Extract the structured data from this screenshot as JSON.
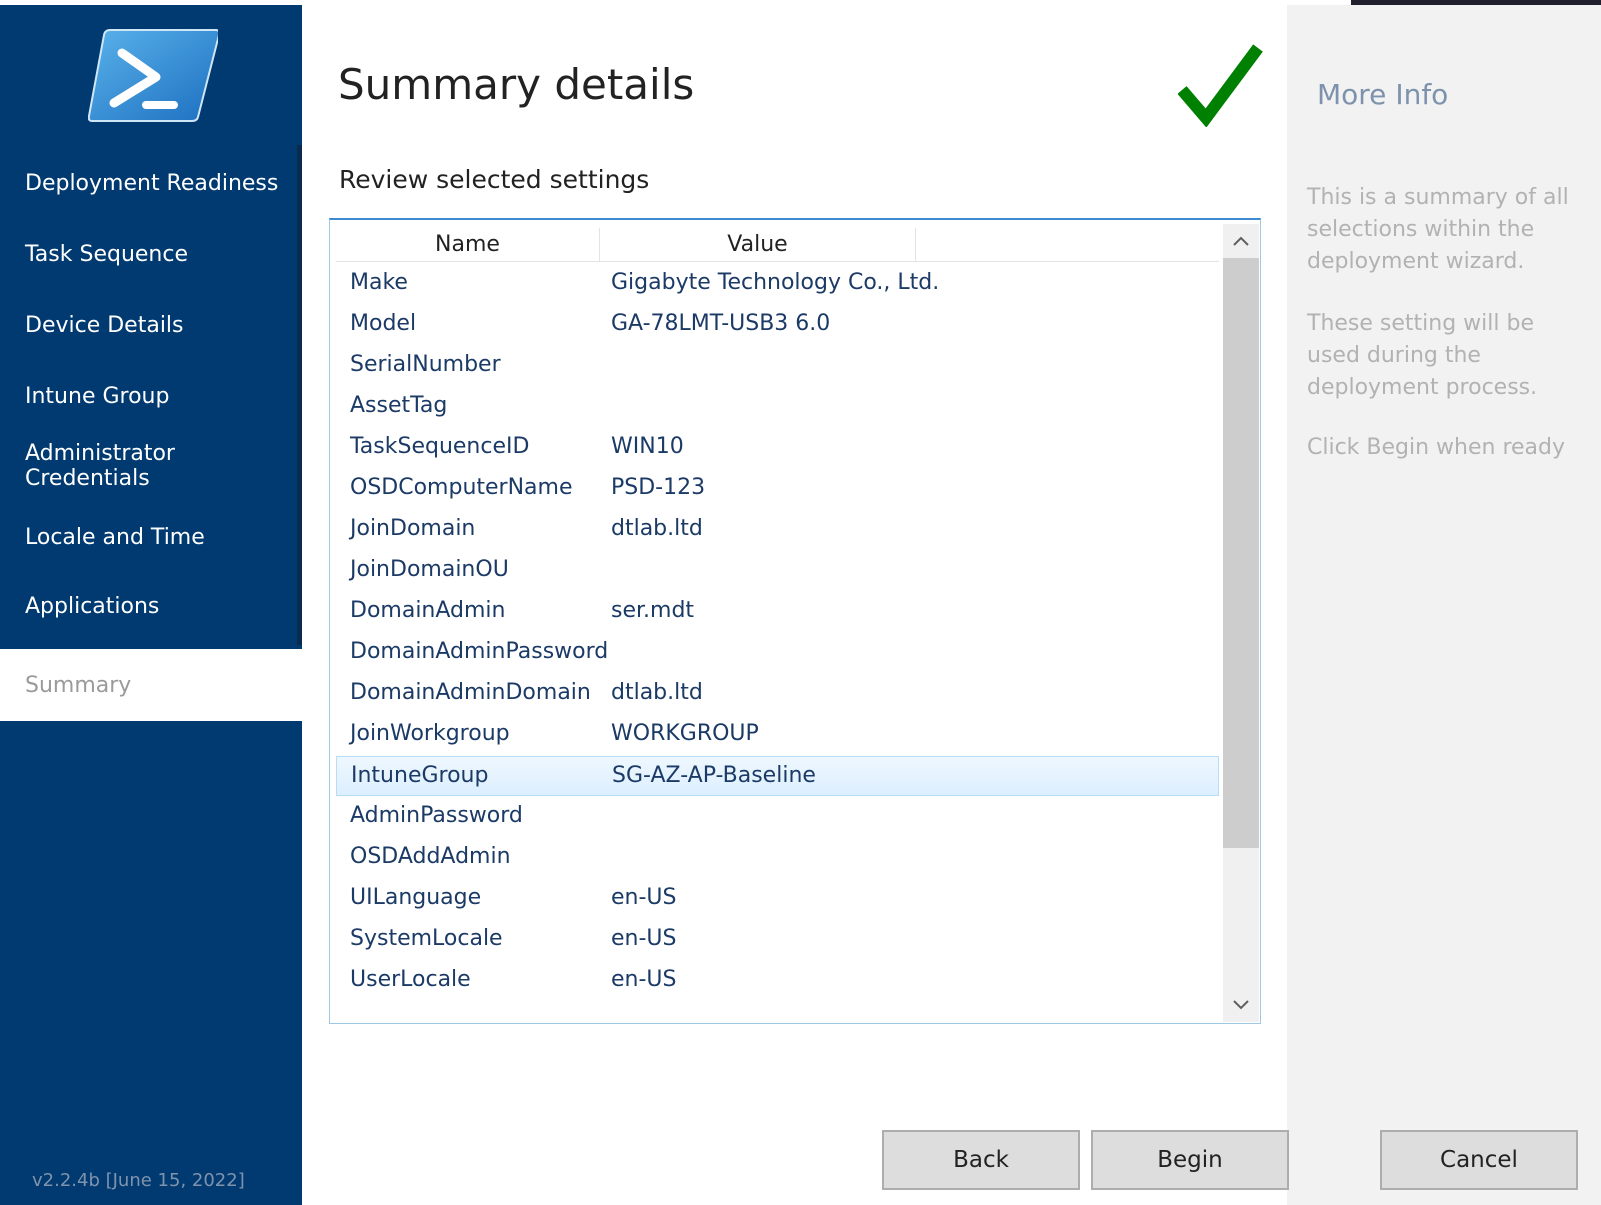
{
  "sidebar": {
    "logo_icon": "powershell-logo-icon",
    "items": [
      {
        "label": "Deployment Readiness"
      },
      {
        "label": "Task Sequence"
      },
      {
        "label": "Device Details"
      },
      {
        "label": "Intune Group"
      },
      {
        "label": "Administrator Credentials"
      },
      {
        "label": "Locale and Time"
      },
      {
        "label": "Applications"
      },
      {
        "label": "Summary",
        "active": true
      }
    ],
    "version": "v2.2.4b [June 15, 2022]",
    "colors": {
      "background": "#003a70",
      "active_background": "#ffffff",
      "active_text": "#9a9a9a"
    }
  },
  "main": {
    "title": "Summary details",
    "status_icon": "checkmark-icon",
    "status_color": "#008000",
    "subtitle": "Review selected settings",
    "grid": {
      "columns": [
        "Name",
        "Value"
      ],
      "rows": [
        {
          "name": "Make",
          "value": "Gigabyte Technology Co., Ltd."
        },
        {
          "name": "Model",
          "value": "GA-78LMT-USB3 6.0"
        },
        {
          "name": "SerialNumber",
          "value": ""
        },
        {
          "name": "AssetTag",
          "value": ""
        },
        {
          "name": "TaskSequenceID",
          "value": "WIN10"
        },
        {
          "name": "OSDComputerName",
          "value": "PSD-123"
        },
        {
          "name": "JoinDomain",
          "value": "dtlab.ltd"
        },
        {
          "name": "JoinDomainOU",
          "value": ""
        },
        {
          "name": "DomainAdmin",
          "value": "ser.mdt"
        },
        {
          "name": "DomainAdminPassword",
          "value": ""
        },
        {
          "name": "DomainAdminDomain",
          "value": "dtlab.ltd"
        },
        {
          "name": "JoinWorkgroup",
          "value": "WORKGROUP"
        },
        {
          "name": "IntuneGroup",
          "value": "SG-AZ-AP-Baseline",
          "selected": true
        },
        {
          "name": "AdminPassword",
          "value": ""
        },
        {
          "name": "OSDAddAdmin",
          "value": ""
        },
        {
          "name": "UILanguage",
          "value": "en-US"
        },
        {
          "name": "SystemLocale",
          "value": "en-US"
        },
        {
          "name": "UserLocale",
          "value": "en-US"
        }
      ],
      "scroll_up_icon": "chevron-up-icon",
      "scroll_down_icon": "chevron-down-icon"
    }
  },
  "info": {
    "title": "More Info",
    "paragraphs": [
      "This is a summary of all selections within the deployment wizard.",
      "These setting will be used during the deployment process.",
      "Click Begin when ready"
    ]
  },
  "buttons": {
    "back": "Back",
    "begin": "Begin",
    "cancel": "Cancel"
  }
}
